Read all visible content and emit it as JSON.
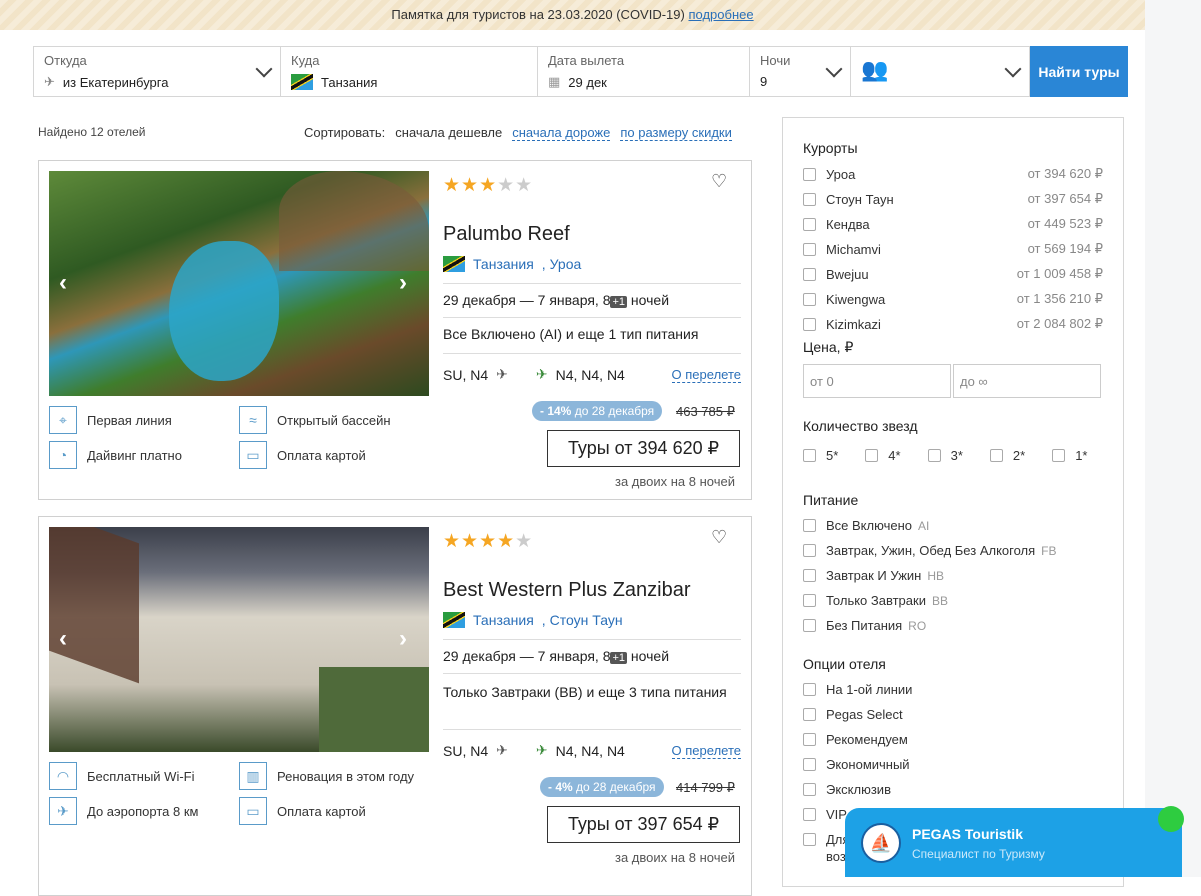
{
  "notice": {
    "text": "Памятка для туристов на 23.03.2020 (COVID-19)",
    "link": "подробнее"
  },
  "search": {
    "from": {
      "label": "Откуда",
      "value": "из Екатеринбурга"
    },
    "to": {
      "label": "Куда",
      "value": "Танзания"
    },
    "date": {
      "label": "Дата вылета",
      "value": "29 дек"
    },
    "nights": {
      "label": "Ночи",
      "value": "9"
    },
    "button": "Найти туры"
  },
  "results": {
    "found": "Найдено 12 отелей",
    "sort_label": "Сортировать:",
    "sort_active": "сначала дешевле",
    "sort_options": [
      "сначала дороже",
      "по размеру скидки"
    ]
  },
  "hotels": [
    {
      "name": "Palumbo Reef",
      "stars": 3,
      "country": "Танзания",
      "resort": "Уроа",
      "dates": "29 декабря — 7 января, 8",
      "plus": "+1",
      "nights_word": "ночей",
      "meal": "Все Включено (AI) и еще 1 тип питания",
      "flight_out": "SU, N4",
      "flight_back": "N4, N4, N4",
      "flight_link": "О перелете",
      "features": [
        "Первая линия",
        "Открытый бассейн",
        "Дайвинг платно",
        "Оплата картой"
      ],
      "discount": "- 14%",
      "discount_note": "до 28 декабря",
      "old_price": "463 785 ₽",
      "price": "Туры от 394 620 ₽",
      "for": "за двоих на 8 ночей"
    },
    {
      "name": "Best Western Plus Zanzibar",
      "stars": 4,
      "country": "Танзания",
      "resort": "Стоун Таун",
      "dates": "29 декабря — 7 января, 8",
      "plus": "+1",
      "nights_word": "ночей",
      "meal": "Только Завтраки (BB) и еще 3 типа питания",
      "flight_out": "SU, N4",
      "flight_back": "N4, N4, N4",
      "flight_link": "О перелете",
      "features": [
        "Бесплатный Wi-Fi",
        "Реновация в этом году",
        "До аэропорта 8 км",
        "Оплата картой"
      ],
      "discount": "- 4%",
      "discount_note": "до 28 декабря",
      "old_price": "414 799 ₽",
      "price": "Туры от 397 654 ₽",
      "for": "за двоих на 8 ночей"
    }
  ],
  "filters": {
    "resorts_title": "Курорты",
    "resorts": [
      {
        "n": "Уроа",
        "p": "от 394 620 ₽"
      },
      {
        "n": "Стоун Таун",
        "p": "от 397 654 ₽"
      },
      {
        "n": "Кендва",
        "p": "от 449 523 ₽"
      },
      {
        "n": "Michamvi",
        "p": "от 569 194 ₽"
      },
      {
        "n": "Bwejuu",
        "p": "от 1 009 458 ₽"
      },
      {
        "n": "Kiwengwa",
        "p": "от 1 356 210 ₽"
      },
      {
        "n": "Kizimkazi",
        "p": "от 2 084 802 ₽"
      }
    ],
    "price_title": "Цена, ₽",
    "price_from": "от  0",
    "price_to": "до  ∞",
    "stars_title": "Количество звезд",
    "stars": [
      "5*",
      "4*",
      "3*",
      "2*",
      "1*"
    ],
    "meal_title": "Питание",
    "meals": [
      {
        "n": "Все Включено",
        "a": "AI"
      },
      {
        "n": "Завтрак, Ужин, Обед Без Алкоголя",
        "a": "FB"
      },
      {
        "n": "Завтрак И Ужин",
        "a": "HB"
      },
      {
        "n": "Только Завтраки",
        "a": "BB"
      },
      {
        "n": "Без Питания",
        "a": "RO"
      }
    ],
    "options_title": "Опции отеля",
    "options": [
      "На 1-ой линии",
      "Pegas Select",
      "Рекомендуем",
      "Экономичный",
      "Эксклюзив",
      "VIP",
      "Для",
      "воз"
    ]
  },
  "chat": {
    "title": "PEGAS Touristik",
    "subtitle": "Специалист по Туризму"
  }
}
